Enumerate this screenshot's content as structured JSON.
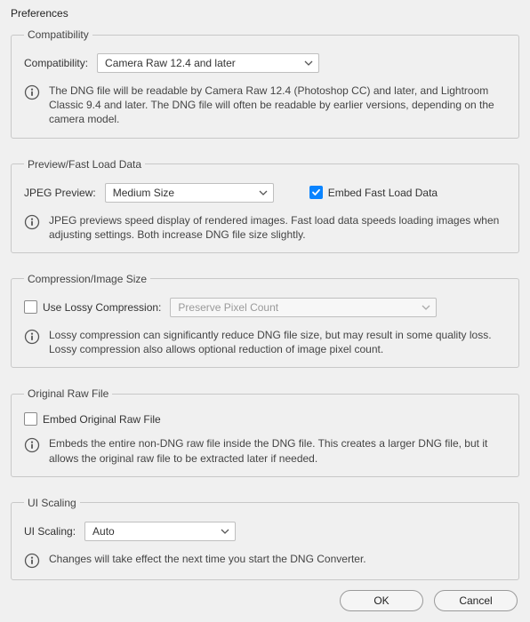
{
  "title": "Preferences",
  "compatibility": {
    "legend": "Compatibility",
    "label": "Compatibility:",
    "value": "Camera Raw 12.4 and later",
    "info": "The DNG file will be readable by Camera Raw 12.4 (Photoshop CC) and later, and Lightroom Classic 9.4 and later. The DNG file will often be readable by earlier versions, depending on the camera model."
  },
  "preview": {
    "legend": "Preview/Fast Load Data",
    "label": "JPEG Preview:",
    "value": "Medium Size",
    "embed_checked": true,
    "embed_label": "Embed Fast Load Data",
    "info": "JPEG previews speed display of rendered images.  Fast load data speeds loading images when adjusting settings.  Both increase DNG file size slightly."
  },
  "compression": {
    "legend": "Compression/Image Size",
    "lossy_checked": false,
    "lossy_label": "Use Lossy Compression:",
    "lossy_value": "Preserve Pixel Count",
    "info": "Lossy compression can significantly reduce DNG file size, but may result in some quality loss.  Lossy compression also allows optional reduction of image pixel count."
  },
  "original": {
    "legend": "Original Raw File",
    "embed_checked": false,
    "embed_label": "Embed Original Raw File",
    "info": "Embeds the entire non-DNG raw file inside the DNG file.  This creates a larger DNG file, but it allows the original raw file to be extracted later if needed."
  },
  "uiscaling": {
    "legend": "UI Scaling",
    "label": "UI Scaling:",
    "value": "Auto",
    "info": "Changes will take effect the next time you start the DNG Converter."
  },
  "buttons": {
    "ok": "OK",
    "cancel": "Cancel"
  }
}
